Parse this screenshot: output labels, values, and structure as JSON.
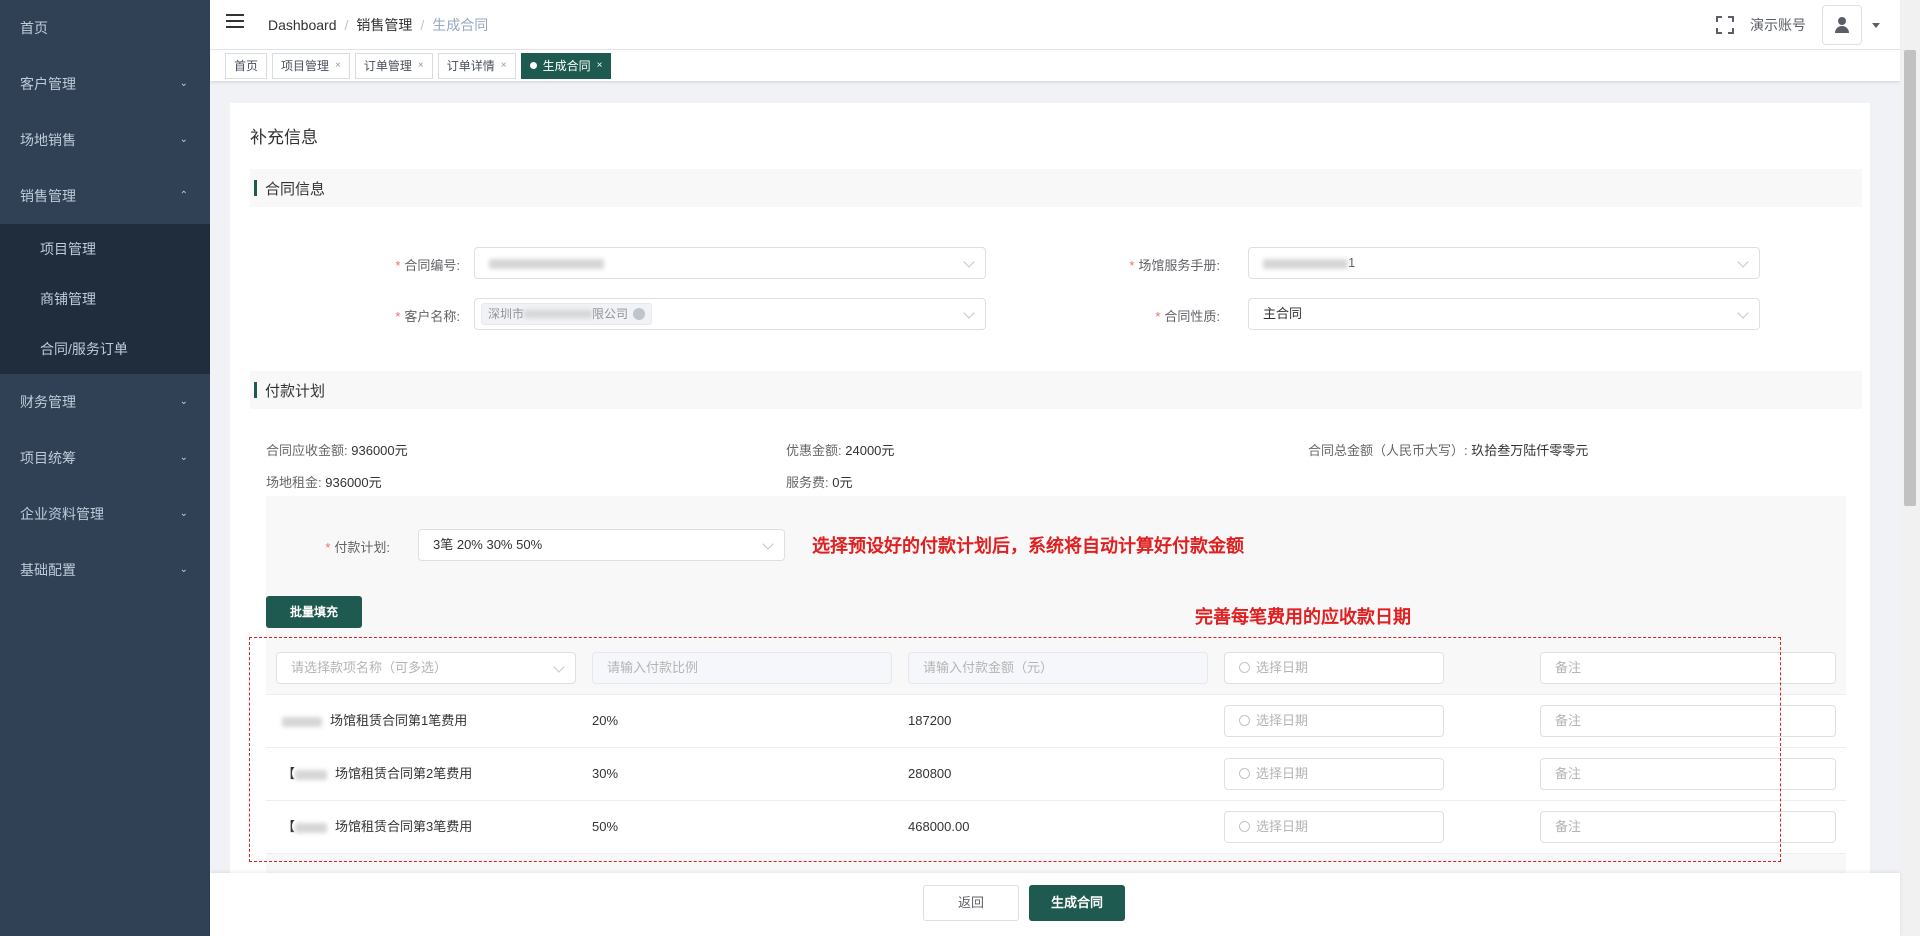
{
  "sidebar": {
    "items": [
      {
        "label": "首页",
        "arrow": ""
      },
      {
        "label": "客户管理",
        "arrow": "v"
      },
      {
        "label": "场地销售",
        "arrow": "v"
      },
      {
        "label": "销售管理",
        "arrow": "^"
      },
      {
        "label": "财务管理",
        "arrow": "v"
      },
      {
        "label": "项目统筹",
        "arrow": "v"
      },
      {
        "label": "企业资料管理",
        "arrow": "v"
      },
      {
        "label": "基础配置",
        "arrow": "v"
      }
    ],
    "submenu": [
      "项目管理",
      "商铺管理",
      "合同/服务订单"
    ]
  },
  "navbar": {
    "breadcrumb": [
      "Dashboard",
      "销售管理",
      "生成合同"
    ],
    "account": "演示账号"
  },
  "tags": [
    "首页",
    "项目管理",
    "订单管理",
    "订单详情",
    "生成合同"
  ],
  "page": {
    "title": "补充信息",
    "section_contract": "合同信息",
    "section_payment": "付款计划",
    "form": {
      "contract_no_label": "合同编号:",
      "venue_manual_label": "场馆服务手册:",
      "venue_manual_suffix": "1",
      "customer_label": "客户名称:",
      "customer_prefix": "深圳市",
      "customer_suffix": "限公司",
      "nature_label": "合同性质:",
      "nature_value": "主合同"
    },
    "info": {
      "receivable_label": "合同应收金额:",
      "receivable_value": "936000元",
      "discount_label": "优惠金额:",
      "discount_value": "24000元",
      "total_cn_label": "合同总金额（人民币大写）:",
      "total_cn_value": "玖拾叁万陆仟零零元",
      "rent_label": "场地租金:",
      "rent_value": "936000元",
      "service_label": "服务费:",
      "service_value": "0元"
    },
    "plan_label": "付款计划:",
    "plan_value": "3笔 20% 30% 50%",
    "batch_fill": "批量填充",
    "annotation_1": "选择预设好的付款计划后，系统将自动计算好付款金额",
    "annotation_2": "完善每笔费用的应收款日期",
    "table_head": {
      "item_placeholder": "请选择款项名称（可多选）",
      "ratio_placeholder": "请输入付款比例",
      "amount_placeholder": "请输入付款金额（元）",
      "date_placeholder": "选择日期",
      "note_placeholder": "备注"
    },
    "rows": [
      {
        "prefix": "",
        "name": "场馆租赁合同第1笔费用",
        "ratio": "20%",
        "amount": "187200",
        "date": "选择日期",
        "note": "备注"
      },
      {
        "prefix": "【",
        "name": "场馆租赁合同第2笔费用",
        "ratio": "30%",
        "amount": "280800",
        "date": "选择日期",
        "note": "备注"
      },
      {
        "prefix": "【",
        "name": "场馆租赁合同第3笔费用",
        "ratio": "50%",
        "amount": "468000.00",
        "date": "选择日期",
        "note": "备注"
      }
    ]
  },
  "footer": {
    "back": "返回",
    "generate": "生成合同"
  },
  "colors": {
    "sidebar_bg": "#304156",
    "accent": "#1e5a50",
    "annotation": "#e02020"
  }
}
